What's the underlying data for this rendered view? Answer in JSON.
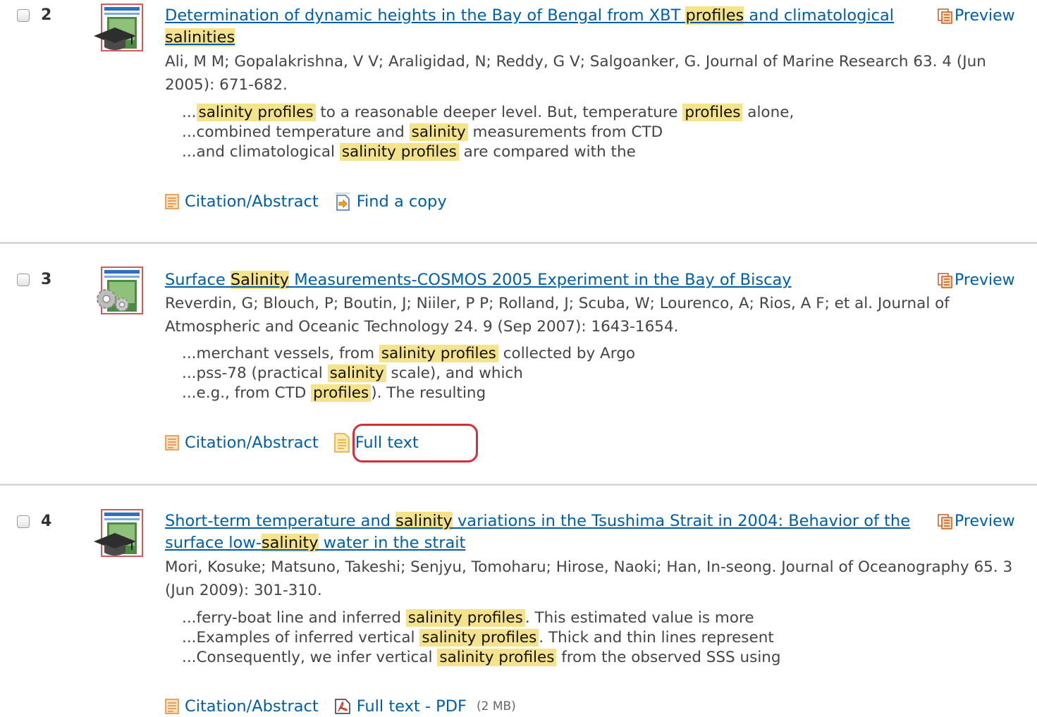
{
  "results": [
    {
      "number": "2",
      "icon": "scholarly-journal-icon",
      "title_parts": [
        {
          "text": "Determination of dynamic heights in the Bay of Bengal from XBT ",
          "hl": false
        },
        {
          "text": "profiles",
          "hl": true
        },
        {
          "text": " and climatological ",
          "hl": false
        },
        {
          "text": "salinities",
          "hl": true
        }
      ],
      "preview_label": "Preview",
      "authors": "Ali, M M; Gopalakrishna, V V; Araligidad, N; Reddy, G V; Salgoanker, G. Journal of Marine Research 63. 4  (Jun 2005): 671-682.",
      "snippets": [
        [
          {
            "text": "...",
            "hl": false
          },
          {
            "text": "salinity profiles",
            "hl": true
          },
          {
            "text": " to a reasonable deeper level. But, temperature ",
            "hl": false
          },
          {
            "text": "profiles",
            "hl": true
          },
          {
            "text": " alone,",
            "hl": false
          }
        ],
        [
          {
            "text": "...combined temperature and ",
            "hl": false
          },
          {
            "text": "salinity",
            "hl": true
          },
          {
            "text": " measurements from CTD",
            "hl": false
          }
        ],
        [
          {
            "text": "...and climatological ",
            "hl": false
          },
          {
            "text": "salinity profiles",
            "hl": true
          },
          {
            "text": " are compared with the",
            "hl": false
          }
        ]
      ],
      "links": {
        "citation": "Citation/Abstract",
        "second": "Find a copy",
        "second_icon": "find-copy-icon",
        "size": ""
      }
    },
    {
      "number": "3",
      "icon": "conference-paper-icon",
      "title_parts": [
        {
          "text": "Surface ",
          "hl": false
        },
        {
          "text": "Salinity",
          "hl": true
        },
        {
          "text": " Measurements-COSMOS 2005 Experiment in the Bay of Biscay",
          "hl": false
        }
      ],
      "preview_label": "Preview",
      "authors": "Reverdin, G; Blouch, P; Boutin, J; Niiler, P P; Rolland, J; Scuba, W; Lourenco, A; Rios, A F; et al. Journal of Atmospheric and Oceanic Technology 24. 9  (Sep 2007): 1643-1654.",
      "snippets": [
        [
          {
            "text": "...merchant vessels, from ",
            "hl": false
          },
          {
            "text": "salinity profiles",
            "hl": true
          },
          {
            "text": " collected by Argo",
            "hl": false
          }
        ],
        [
          {
            "text": "...pss-78 (practical ",
            "hl": false
          },
          {
            "text": "salinity",
            "hl": true
          },
          {
            "text": " scale), and which",
            "hl": false
          }
        ],
        [
          {
            "text": "...e.g., from CTD ",
            "hl": false
          },
          {
            "text": "profiles",
            "hl": true
          },
          {
            "text": "). The resulting",
            "hl": false
          }
        ]
      ],
      "links": {
        "citation": "Citation/Abstract",
        "second": "Full text",
        "second_icon": "full-text-icon",
        "size": ""
      }
    },
    {
      "number": "4",
      "icon": "scholarly-journal-icon",
      "title_parts": [
        {
          "text": "Short-term temperature and ",
          "hl": false
        },
        {
          "text": "salinity",
          "hl": true
        },
        {
          "text": " variations in the Tsushima Strait in 2004: Behavior of the surface low-",
          "hl": false
        },
        {
          "text": "salinity",
          "hl": true
        },
        {
          "text": " water in the strait",
          "hl": false
        }
      ],
      "preview_label": "Preview",
      "authors": "Mori, Kosuke; Matsuno, Takeshi; Senjyu, Tomoharu; Hirose, Naoki; Han, In-seong. Journal of Oceanography 65. 3  (Jun 2009): 301-310.",
      "snippets": [
        [
          {
            "text": "...ferry-boat line and inferred ",
            "hl": false
          },
          {
            "text": "salinity profiles",
            "hl": true
          },
          {
            "text": ". This estimated value is more",
            "hl": false
          }
        ],
        [
          {
            "text": "...Examples of inferred vertical ",
            "hl": false
          },
          {
            "text": "salinity profiles",
            "hl": true
          },
          {
            "text": ". Thick and thin lines represent",
            "hl": false
          }
        ],
        [
          {
            "text": "...Consequently, we infer vertical ",
            "hl": false
          },
          {
            "text": "salinity profiles",
            "hl": true
          },
          {
            "text": " from the observed SSS using",
            "hl": false
          }
        ]
      ],
      "links": {
        "citation": "Citation/Abstract",
        "second": "Full text - PDF",
        "second_icon": "pdf-icon",
        "size": "(2 MB)"
      }
    }
  ],
  "colors": {
    "link": "#005ea8",
    "highlight": "#f5e38c",
    "annotation_circle": "#d32f3b"
  }
}
